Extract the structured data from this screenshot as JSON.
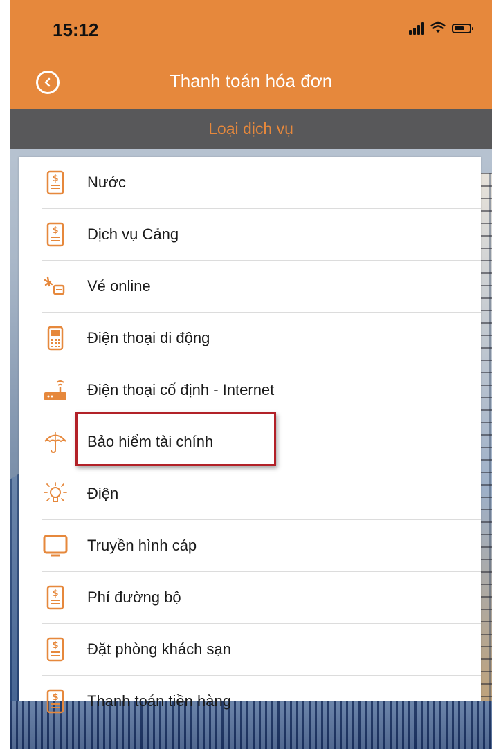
{
  "status_bar": {
    "time": "15:12"
  },
  "nav": {
    "title": "Thanh toán hóa đơn"
  },
  "section": {
    "header": "Loại dịch vụ"
  },
  "colors": {
    "accent": "#e6883c",
    "header_bg": "#58585a",
    "highlight": "#b22128"
  },
  "services": [
    {
      "label": "Nước",
      "icon": "bill-icon"
    },
    {
      "label": "Dịch vụ Cảng",
      "icon": "bill-icon"
    },
    {
      "label": "Vé online",
      "icon": "ticket-icon"
    },
    {
      "label": "Điện thoại di động",
      "icon": "mobile-phone-icon"
    },
    {
      "label": "Điện thoại cố định - Internet",
      "icon": "router-icon"
    },
    {
      "label": "Bảo hiểm tài chính",
      "icon": "umbrella-icon"
    },
    {
      "label": "Điện",
      "icon": "lightbulb-icon"
    },
    {
      "label": "Truyền hình cáp",
      "icon": "tv-icon"
    },
    {
      "label": "Phí đường bộ",
      "icon": "bill-icon"
    },
    {
      "label": "Đặt phòng khách sạn",
      "icon": "bill-icon"
    },
    {
      "label": "Thanh toán tiền hàng",
      "icon": "bill-icon"
    }
  ]
}
